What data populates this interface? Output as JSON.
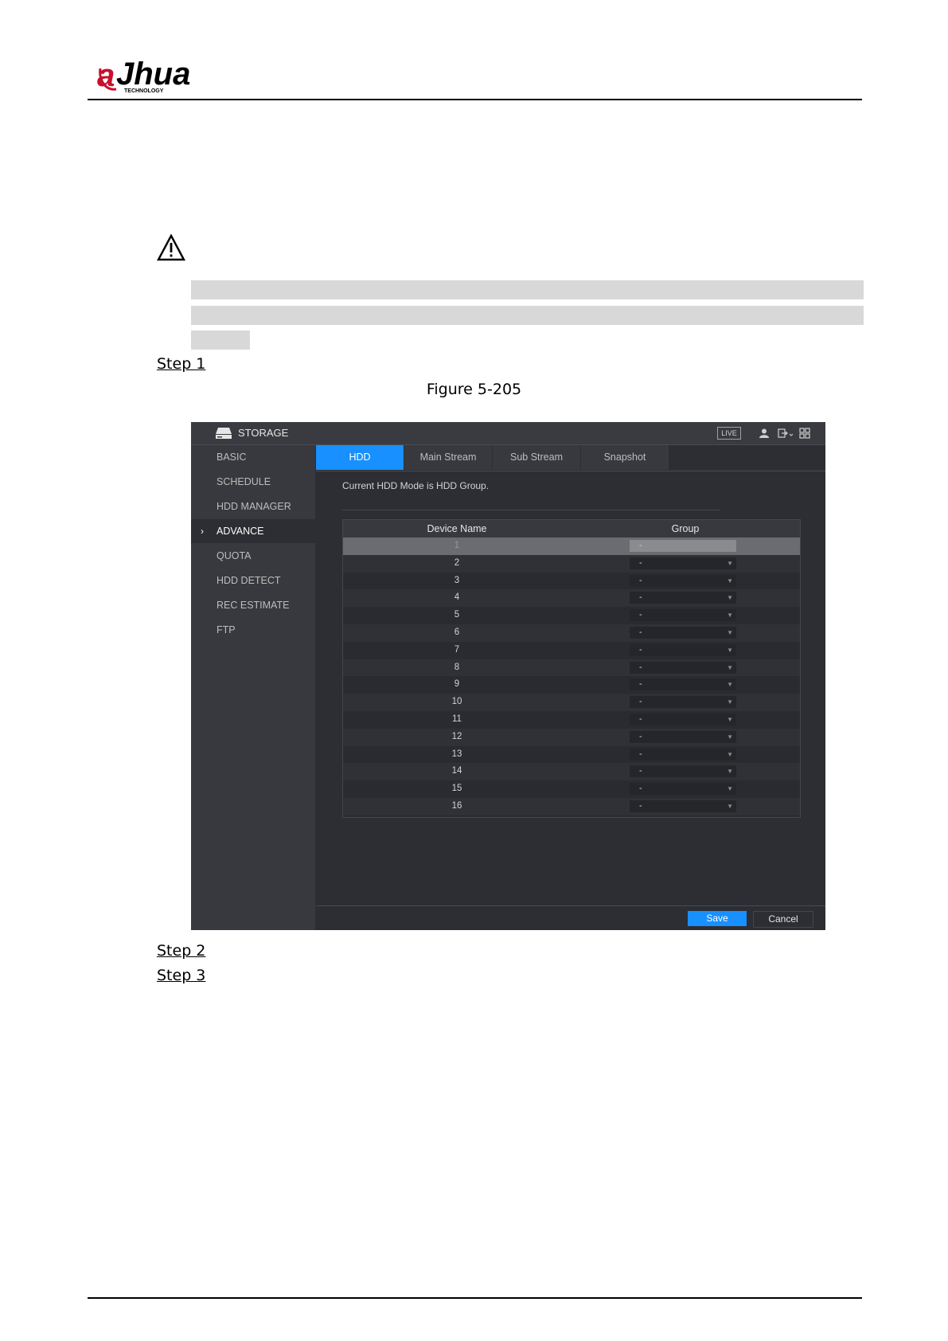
{
  "brand": {
    "logo_text": "alhua",
    "logo_subtext": "TECHNOLOGY"
  },
  "steps": [
    "Step 1",
    "Step 2",
    "Step 3"
  ],
  "figure_caption": "Figure 5-205",
  "ui": {
    "window_title": "STORAGE",
    "live_badge": "LIVE",
    "sidebar": [
      {
        "label": "BASIC"
      },
      {
        "label": "SCHEDULE"
      },
      {
        "label": "HDD MANAGER"
      },
      {
        "label": "ADVANCE",
        "active": true
      },
      {
        "label": "QUOTA"
      },
      {
        "label": "HDD DETECT"
      },
      {
        "label": "REC ESTIMATE"
      },
      {
        "label": "FTP"
      }
    ],
    "tabs": [
      {
        "label": "HDD",
        "active": true
      },
      {
        "label": "Main Stream"
      },
      {
        "label": "Sub Stream"
      },
      {
        "label": "Snapshot"
      }
    ],
    "note": "Current HDD Mode is HDD Group.",
    "table": {
      "headers": [
        "Device Name",
        "Group"
      ],
      "rows": [
        {
          "name": "1",
          "group": "-"
        },
        {
          "name": "2",
          "group": "-"
        },
        {
          "name": "3",
          "group": "-"
        },
        {
          "name": "4",
          "group": "-"
        },
        {
          "name": "5",
          "group": "-"
        },
        {
          "name": "6",
          "group": "-"
        },
        {
          "name": "7",
          "group": "-"
        },
        {
          "name": "8",
          "group": "-"
        },
        {
          "name": "9",
          "group": "-"
        },
        {
          "name": "10",
          "group": "-"
        },
        {
          "name": "11",
          "group": "-"
        },
        {
          "name": "12",
          "group": "-"
        },
        {
          "name": "13",
          "group": "-"
        },
        {
          "name": "14",
          "group": "-"
        },
        {
          "name": "15",
          "group": "-"
        },
        {
          "name": "16",
          "group": "-"
        }
      ],
      "selected_row": "1"
    },
    "buttons": {
      "save": "Save",
      "cancel": "Cancel"
    },
    "colors": {
      "accent": "#1890ff",
      "window_bg": "#2d2e33",
      "sidebar_bg": "#38393e"
    }
  }
}
